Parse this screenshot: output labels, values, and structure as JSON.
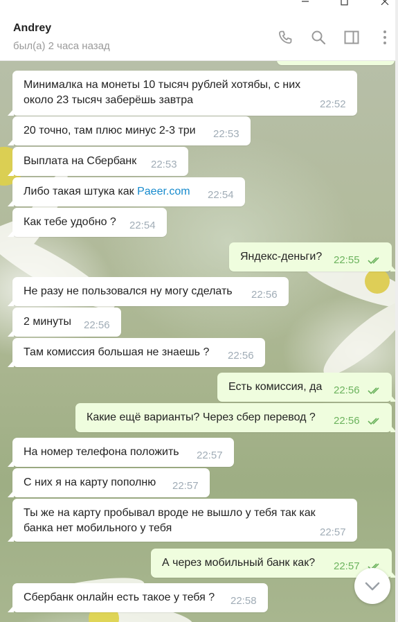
{
  "header": {
    "name": "Andrey",
    "status": "был(а) 2 часа назад",
    "icons": [
      "phone-icon",
      "search-icon",
      "sidebar-icon",
      "more-icon"
    ]
  },
  "titlebar": {
    "icons": [
      "close-icon",
      "maximize-icon",
      "minimize-icon"
    ]
  },
  "colors": {
    "incoming": "#ffffff",
    "outgoing": "#effdde",
    "link": "#168acd",
    "out_time": "#6cb35e",
    "in_time": "#a0acb6"
  },
  "messages": [
    {
      "dir": "in",
      "lines": [
        "Минималка на монеты 10 тысяч рублей хотябы, с них",
        "около 23 тысяч заберёшь завтра"
      ],
      "time": "22:52"
    },
    {
      "dir": "in",
      "text": "20 точно, там плюс минус 2-3 три",
      "time": "22:53"
    },
    {
      "dir": "in",
      "text": "Выплата на Сбербанк",
      "time": "22:53"
    },
    {
      "dir": "in",
      "text": "Либо такая штука как ",
      "link": "Paeer.com",
      "time": "22:54"
    },
    {
      "dir": "in",
      "text": "Как тебе удобно ?",
      "time": "22:54"
    },
    {
      "dir": "out",
      "text": "Яндекс-деньги?",
      "time": "22:55",
      "read": true
    },
    {
      "dir": "in",
      "text": "Не разу не пользовался ну могу сделать",
      "time": "22:56"
    },
    {
      "dir": "in",
      "text": "2 минуты",
      "time": "22:56"
    },
    {
      "dir": "in",
      "text": "Там комиссия большая не знаешь ?",
      "time": "22:56"
    },
    {
      "dir": "out",
      "text": "Есть комиссия, да",
      "time": "22:56",
      "read": true
    },
    {
      "dir": "out",
      "text": "Какие ещё варианты? Через сбер перевод ?",
      "time": "22:56",
      "read": true
    },
    {
      "dir": "in",
      "text": "На номер телефона положить",
      "time": "22:57"
    },
    {
      "dir": "in",
      "text": "С них я на карту пополню",
      "time": "22:57"
    },
    {
      "dir": "in",
      "lines": [
        "Ты же на карту пробывал вроде не вышло у тебя так как",
        "банка нет мобильного у тебя"
      ],
      "time": "22:57"
    },
    {
      "dir": "out",
      "text": "А через мобильный банк как?",
      "time": "22:57",
      "read": true
    },
    {
      "dir": "in",
      "text": "Сбербанк онлайн есть такое у тебя ?",
      "time": "22:58"
    }
  ]
}
